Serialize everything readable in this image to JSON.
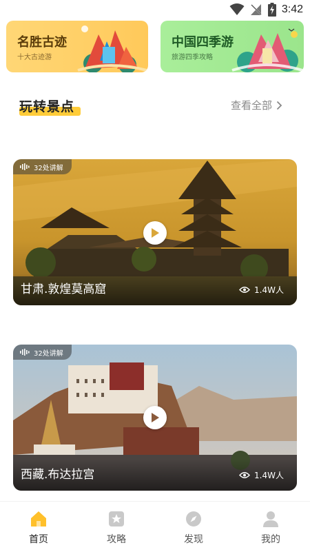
{
  "status_bar": {
    "time": "3:42"
  },
  "promos": [
    {
      "title": "名胜古迹",
      "subtitle": "十大古迹游"
    },
    {
      "title": "中国四季游",
      "subtitle": "旅游四季攻略"
    }
  ],
  "section": {
    "title": "玩转景点",
    "view_all": "查看全部"
  },
  "attractions": [
    {
      "badge": "32处讲解",
      "name": "甘肃.敦煌莫高窟",
      "views": "1.4W人"
    },
    {
      "badge": "32处讲解",
      "name": "西藏.布达拉宫",
      "views": "1.4W人"
    }
  ],
  "nav": {
    "items": [
      {
        "label": "首页",
        "icon": "home-icon"
      },
      {
        "label": "攻略",
        "icon": "star-icon"
      },
      {
        "label": "发现",
        "icon": "compass-icon"
      },
      {
        "label": "我的",
        "icon": "user-icon"
      }
    ],
    "active_color": "#ffc02b",
    "inactive_color": "#c9c9c9"
  }
}
